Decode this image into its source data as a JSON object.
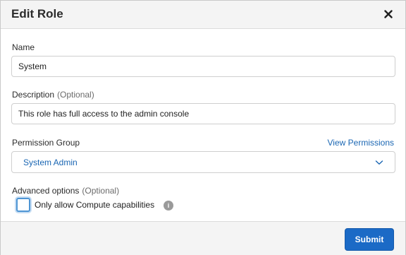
{
  "dialog": {
    "title": "Edit Role",
    "close_icon": "close-icon"
  },
  "form": {
    "name_label": "Name",
    "name_value": "System",
    "description_label": "Description",
    "description_optional": "(Optional)",
    "description_value": "This role has full access to the admin console",
    "permission_group_label": "Permission Group",
    "view_permissions_link": "View Permissions",
    "permission_group_value": "System Admin",
    "advanced_label": "Advanced options",
    "advanced_optional": "(Optional)",
    "compute_only_label": "Only allow Compute capabilities",
    "compute_only_checked": false,
    "info_icon": "i"
  },
  "footer": {
    "submit_label": "Submit"
  },
  "colors": {
    "accent": "#1b6ac6",
    "link": "#1a66b3",
    "header_bg": "#f4f4f4"
  }
}
